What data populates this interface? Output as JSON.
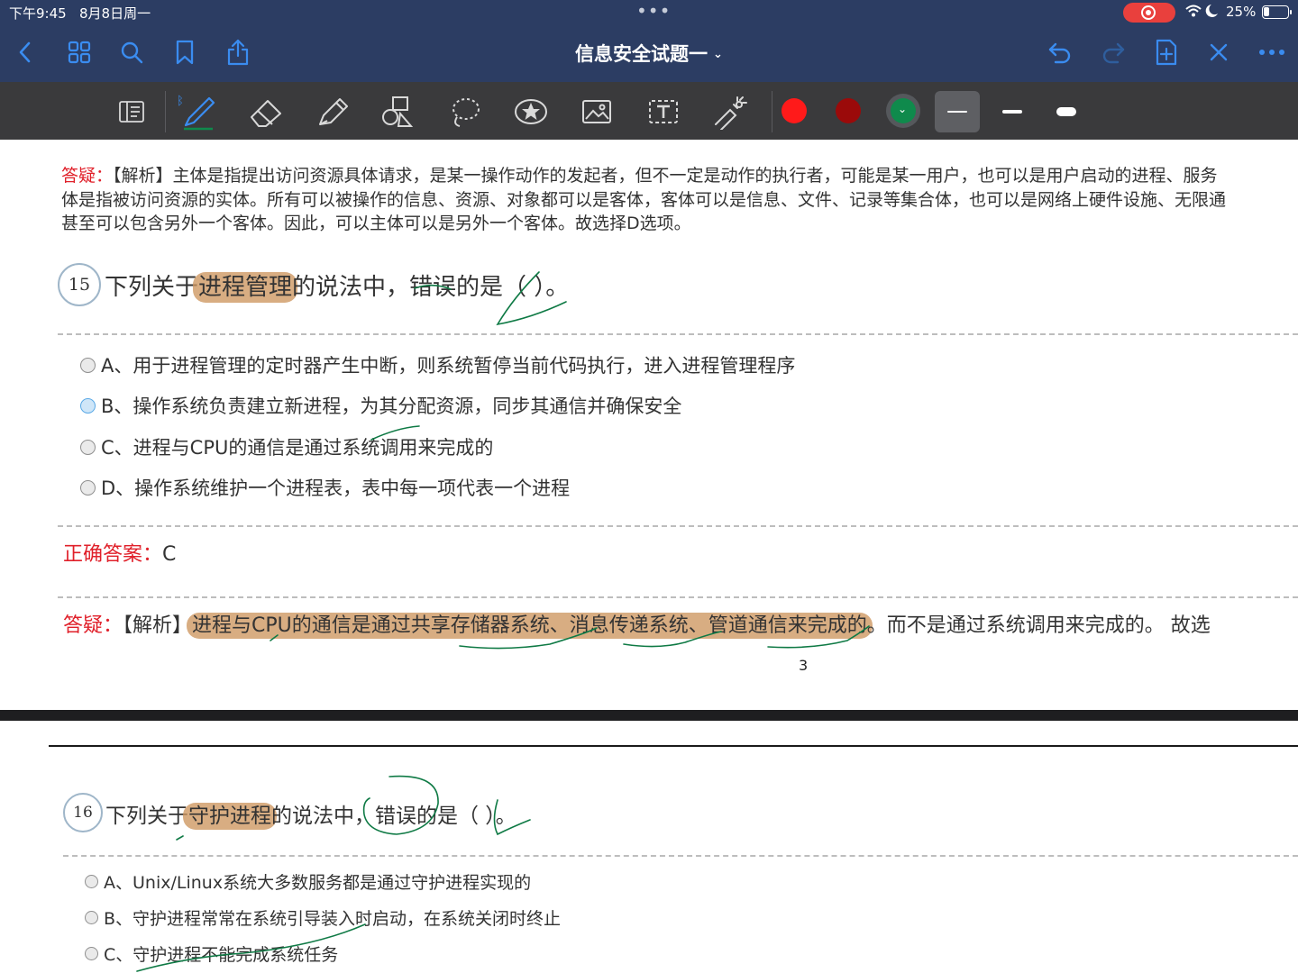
{
  "status_bar": {
    "time": "下午9:45",
    "date": "8月8日周一",
    "battery": "25%",
    "battery_level": 0.25
  },
  "nav": {
    "title": "信息安全试题一",
    "left_icons": [
      "back-icon",
      "grid-icon",
      "search-icon",
      "bookmark-icon",
      "share-icon"
    ],
    "right_icons": [
      "undo-icon",
      "redo-icon",
      "add-page-icon",
      "close-icon",
      "more-icon"
    ]
  },
  "toolbar": {
    "tools": [
      "reader-icon",
      "pen-icon",
      "eraser-icon",
      "highlighter-icon",
      "shapes-icon",
      "lasso-icon",
      "sticker-icon",
      "image-icon",
      "text-icon",
      "laser-icon"
    ],
    "colors": [
      "#ff1a1a",
      "#9b0a0a",
      "#0f8a4c"
    ],
    "selected_color": "#0f8a4c",
    "stroke_widths": [
      "thin",
      "medium",
      "thick"
    ],
    "selected_stroke": "thin"
  },
  "page1": {
    "prev_explain": {
      "label": "答疑：",
      "line1": "【解析】主体是指提出访问资源具体请求，是某一操作动作的发起者，但不一定是动作的执行者，可能是某一用户，也可以是用户启动的进程、服务",
      "line2": "体是指被访问资源的实体。所有可以被操作的信息、资源、对象都可以是客体，客体可以是信息、文件、记录等集合体，也可以是网络上硬件设施、无限通",
      "line3": "甚至可以包含另外一个客体。因此，可以主体可以是另外一个客体。故选择D选项。"
    },
    "q15": {
      "number": "15",
      "text_pre": "下列关于",
      "text_hl": "进程管理",
      "text_post": "的说法中，错误的是（ ）。",
      "options": [
        "A、用于进程管理的定时器产生中断，则系统暂停当前代码执行，进入进程管理程序",
        "B、操作系统负责建立新进程，为其分配资源，同步其通信并确保安全",
        "C、进程与CPU的通信是通过系统调用来完成的",
        "D、操作系统维护一个进程表，表中每一项代表一个进程"
      ],
      "answer_label": "正确答案：",
      "answer": "C",
      "explain_label": "答疑：",
      "explain_pre": "【解析】",
      "explain_hl": "进程与CPU的通信是通过共享存储器系统、消息传递系统、管道通信来完成的",
      "explain_post": "。而不是通过系统调用来完成的。 故选"
    },
    "page_number": "3"
  },
  "page2": {
    "q16": {
      "number": "16",
      "text_pre": "下列关于",
      "text_hl": "守护进程",
      "text_post": "的说法中，错误的是（ ）。",
      "options": [
        "A、Unix/Linux系统大多数服务都是通过守护进程实现的",
        "B、守护进程常常在系统引导装入时启动，在系统关闭时终止",
        "C、守护进程不能完成系统任务"
      ]
    }
  }
}
